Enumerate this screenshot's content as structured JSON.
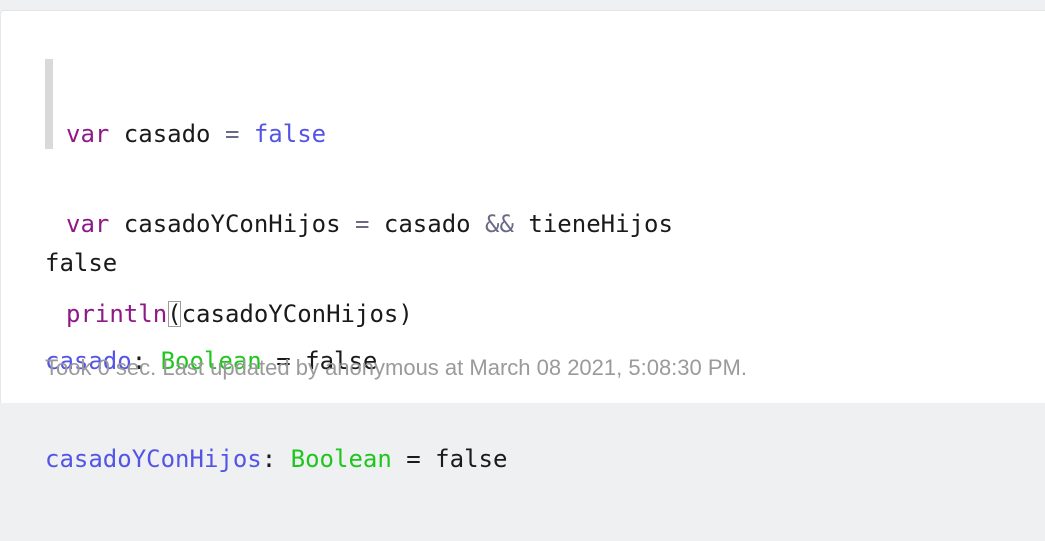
{
  "code": {
    "line1": {
      "kw": "var",
      "name": " casado ",
      "op": "=",
      "value": " false"
    },
    "line2": {
      "kw": "var",
      "name": " casadoYConHijos ",
      "op1": "=",
      "left": " casado ",
      "op2": "&&",
      "right": " tieneHijos"
    },
    "line3": {
      "fn": "println",
      "paren_open": "(",
      "arg": "casadoYConHijos",
      "paren_close": ")"
    }
  },
  "output": {
    "result": "false",
    "vars": [
      {
        "name": "casado",
        "colon": ": ",
        "type": "Boolean",
        "eq": " = ",
        "value": "false"
      },
      {
        "name": "casadoYConHijos",
        "colon": ": ",
        "type": "Boolean",
        "eq": " = ",
        "value": "false"
      }
    ]
  },
  "footer": {
    "status": "Took 0 sec. Last updated by anonymous at March 08 2021, 5:08:30 PM."
  },
  "colors": {
    "keyword": "#8e1a88",
    "boolean": "#5454e6",
    "type": "#1ec61e",
    "status_text": "#9a9a9a"
  }
}
